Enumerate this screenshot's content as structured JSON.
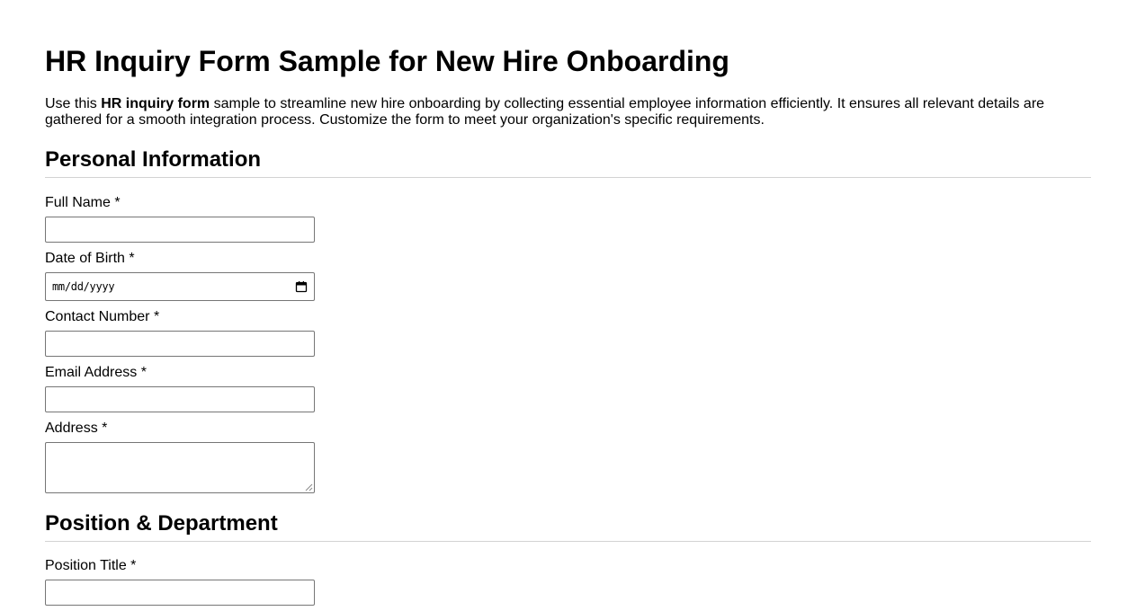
{
  "page": {
    "title": "HR Inquiry Form Sample for New Hire Onboarding",
    "intro_prefix": "Use this ",
    "intro_bold": "HR inquiry form",
    "intro_suffix": " sample to streamline new hire onboarding by collecting essential employee information efficiently. It ensures all relevant details are gathered for a smooth integration process. Customize the form to meet your organization's specific requirements."
  },
  "sections": {
    "personal": {
      "title": "Personal Information",
      "fields": {
        "full_name": {
          "label": "Full Name *",
          "value": ""
        },
        "dob": {
          "label": "Date of Birth *",
          "placeholder": "mm/dd/yyyy"
        },
        "contact": {
          "label": "Contact Number *",
          "value": ""
        },
        "email": {
          "label": "Email Address *",
          "value": ""
        },
        "address": {
          "label": "Address *",
          "value": ""
        }
      }
    },
    "position": {
      "title": "Position & Department",
      "fields": {
        "position_title": {
          "label": "Position Title *",
          "value": ""
        }
      }
    }
  },
  "icons": {
    "date_picker": "calendar-icon",
    "textarea_resize": "resize-grip-icon"
  },
  "colors": {
    "text": "#000000",
    "input_border": "#767676",
    "divider": "#d3d3d3",
    "background": "#ffffff"
  }
}
